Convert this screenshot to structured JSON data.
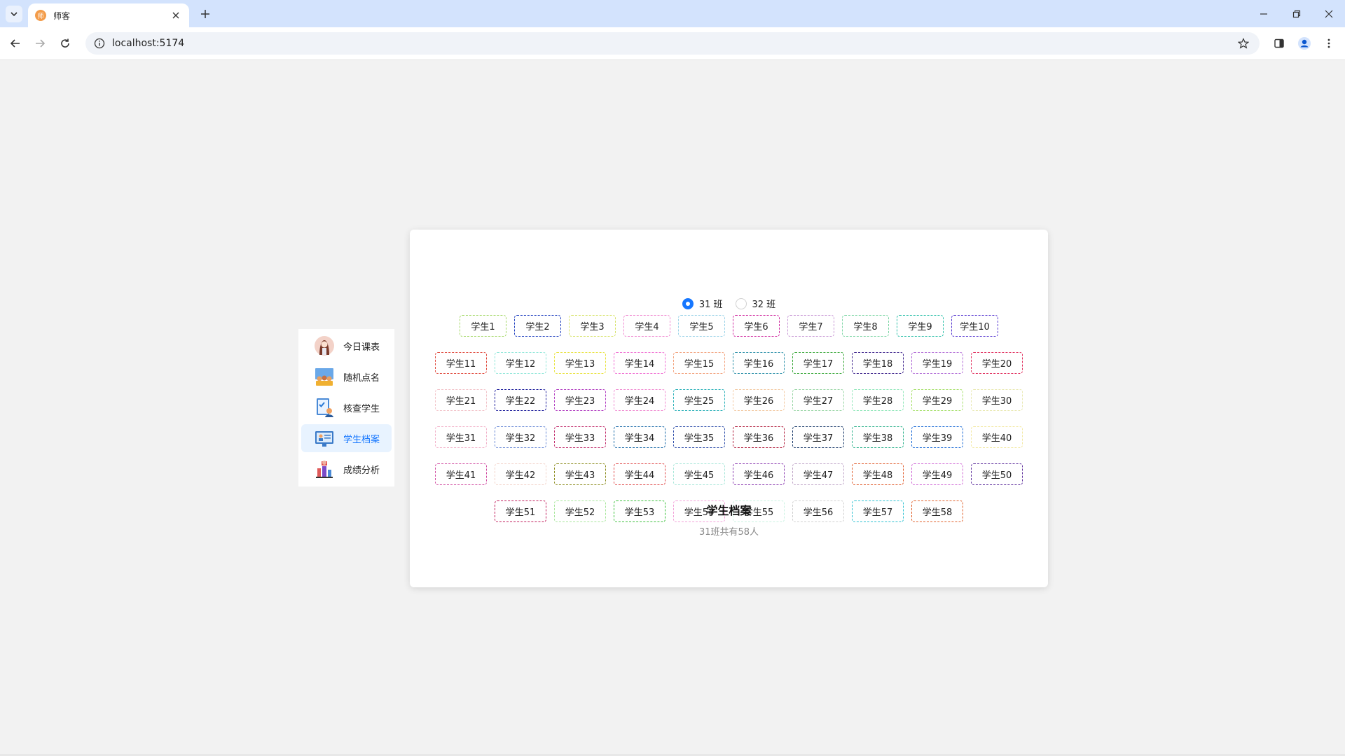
{
  "browser": {
    "tab_title": "师客",
    "favicon_text": "师",
    "url": "localhost:5174"
  },
  "sidebar": {
    "items": [
      {
        "label": "今日课表",
        "icon": "teacher-avatar-icon",
        "active": false
      },
      {
        "label": "随机点名",
        "icon": "classroom-icon",
        "active": false
      },
      {
        "label": "核查学生",
        "icon": "checklist-icon",
        "active": false
      },
      {
        "label": "学生档案",
        "icon": "profile-card-icon",
        "active": true
      },
      {
        "label": "成绩分析",
        "icon": "chart-analysis-icon",
        "active": false
      }
    ]
  },
  "classes": {
    "options": [
      {
        "label": "31 班",
        "checked": true
      },
      {
        "label": "32 班",
        "checked": false
      }
    ]
  },
  "students": [
    {
      "name": "学生1",
      "color": "#a6d96a"
    },
    {
      "name": "学生2",
      "color": "#1f3fbf"
    },
    {
      "name": "学生3",
      "color": "#d7e36b"
    },
    {
      "name": "学生4",
      "color": "#f08ad1"
    },
    {
      "name": "学生5",
      "color": "#9bd3e8"
    },
    {
      "name": "学生6",
      "color": "#d02aa0"
    },
    {
      "name": "学生7",
      "color": "#c99ad6"
    },
    {
      "name": "学生8",
      "color": "#7fd6a6"
    },
    {
      "name": "学生9",
      "color": "#2bbfa8"
    },
    {
      "name": "学生10",
      "color": "#5a3bd1"
    },
    {
      "name": "学生11",
      "color": "#e0473a"
    },
    {
      "name": "学生12",
      "color": "#8ee6d8"
    },
    {
      "name": "学生13",
      "color": "#e8e23a"
    },
    {
      "name": "学生14",
      "color": "#f06bd2"
    },
    {
      "name": "学生15",
      "color": "#f2a07a"
    },
    {
      "name": "学生16",
      "color": "#2a8fa8"
    },
    {
      "name": "学生17",
      "color": "#3aa83a"
    },
    {
      "name": "学生18",
      "color": "#3a1f8a"
    },
    {
      "name": "学生19",
      "color": "#b06ad6"
    },
    {
      "name": "学生20",
      "color": "#e02a5a"
    },
    {
      "name": "学生21",
      "color": "#f2c2c8"
    },
    {
      "name": "学生22",
      "color": "#1a1a9a"
    },
    {
      "name": "学生23",
      "color": "#b03ac0"
    },
    {
      "name": "学生24",
      "color": "#f08ad1"
    },
    {
      "name": "学生25",
      "color": "#2ab0b8"
    },
    {
      "name": "学生26",
      "color": "#f2c8a0"
    },
    {
      "name": "学生27",
      "color": "#9ad6a6"
    },
    {
      "name": "学生28",
      "color": "#8ee6b8"
    },
    {
      "name": "学生29",
      "color": "#a6e06a"
    },
    {
      "name": "学生30",
      "color": "#e8e8b0"
    },
    {
      "name": "学生31",
      "color": "#f2b0c8"
    },
    {
      "name": "学生32",
      "color": "#6a8ad6"
    },
    {
      "name": "学生33",
      "color": "#c02a6a"
    },
    {
      "name": "学生34",
      "color": "#1a6aa8"
    },
    {
      "name": "学生35",
      "color": "#2a4aa8"
    },
    {
      "name": "学生36",
      "color": "#b01a3a"
    },
    {
      "name": "学生37",
      "color": "#1a3a6a"
    },
    {
      "name": "学生38",
      "color": "#2ab08a"
    },
    {
      "name": "学生39",
      "color": "#1a6ad6"
    },
    {
      "name": "学生40",
      "color": "#f2e8a0"
    },
    {
      "name": "学生41",
      "color": "#d04aa0"
    },
    {
      "name": "学生42",
      "color": "#f2d2c8"
    },
    {
      "name": "学生43",
      "color": "#8a8a1a"
    },
    {
      "name": "学生44",
      "color": "#e04a4a"
    },
    {
      "name": "学生45",
      "color": "#a6e6d8"
    },
    {
      "name": "学生46",
      "color": "#8a3ab0"
    },
    {
      "name": "学生47",
      "color": "#c0a6c8"
    },
    {
      "name": "学生48",
      "color": "#e05a2a"
    },
    {
      "name": "学生49",
      "color": "#d06ad6"
    },
    {
      "name": "学生50",
      "color": "#5a2a9a"
    },
    {
      "name": "学生51",
      "color": "#c01a5a"
    },
    {
      "name": "学生52",
      "color": "#a6e69a"
    },
    {
      "name": "学生53",
      "color": "#3ac03a"
    },
    {
      "name": "学生54",
      "color": "#f2a0d8"
    },
    {
      "name": "学生55",
      "color": "#c8f2e0"
    },
    {
      "name": "学生56",
      "color": "#d0d0d0"
    },
    {
      "name": "学生57",
      "color": "#2ac0d0"
    },
    {
      "name": "学生58",
      "color": "#e0602a"
    }
  ],
  "card": {
    "title": "学生档案",
    "description": "31班共有58人"
  }
}
